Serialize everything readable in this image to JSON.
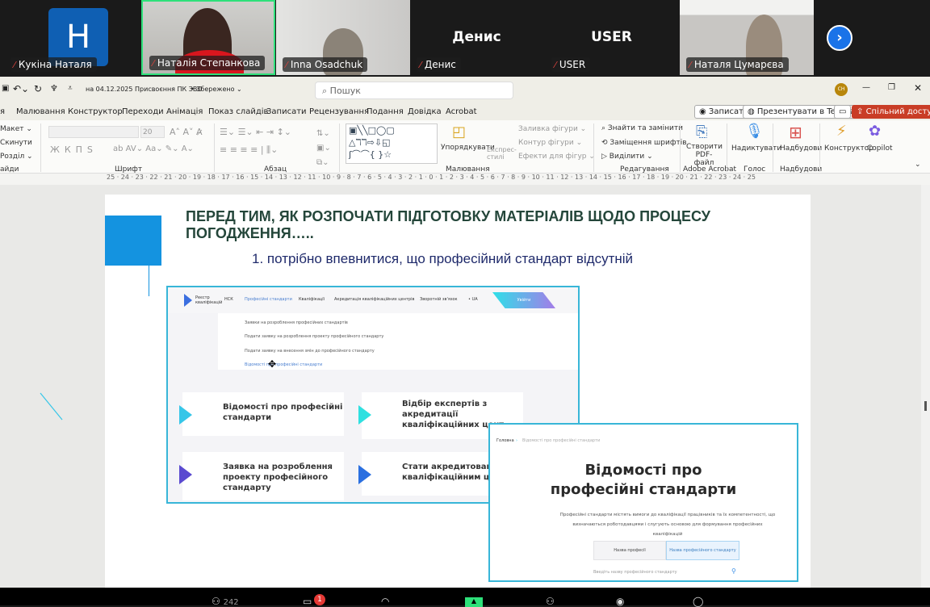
{
  "meeting": {
    "participants": [
      {
        "name": "Кукіна Наталя",
        "avatar_letter": "Н",
        "muted": true
      },
      {
        "name": "Наталія Степанкова",
        "video": true,
        "muted": true,
        "active_speaker": true
      },
      {
        "name": "Inna Osadchuk",
        "video": true,
        "muted": true
      },
      {
        "name": "Денис",
        "display_name": "Денис",
        "muted": true
      },
      {
        "name": "USER",
        "display_name": "USER",
        "muted": true
      },
      {
        "name": "Наталя Цумарєва",
        "video": true,
        "muted": true
      }
    ],
    "next_icon": "chevron-right-icon",
    "toolbar": {
      "participants_count": "242",
      "chat_badge": "1"
    }
  },
  "app": {
    "doc_title": "на 04.12.2025 Присвоєння ПК ЗВО",
    "saved": "• Збережено ⌄",
    "search_placeholder": "Пошук",
    "user_initials": "СН",
    "tabs": [
      "я",
      "Малювання",
      "Конструктор",
      "Переходи",
      "Анімація",
      "Показ слайдів",
      "Записати",
      "Рецензування",
      "Подання",
      "Довідка",
      "Acrobat"
    ],
    "record_btn": "Записати",
    "teams_btn": "Презентувати в Teams",
    "share_btn": "Спільний доступ",
    "accent": "#c93d26"
  },
  "ribbon": {
    "slides": [
      "Макет ⌄",
      "Скинути",
      "Розділ ⌄"
    ],
    "slides_group": "айди",
    "font_size": "20",
    "font_group": "Шрифт",
    "para_group": "Абзац",
    "arrange": "Упорядкувати",
    "express": "Експрес-стилі",
    "fill": "Заливка фігури ⌄",
    "outline": "Контур фігури ⌄",
    "effects": "Ефекти для фігур ⌄",
    "draw_group": "Малювання",
    "find": "Знайти та замінити",
    "replace_fonts": "Заміщення шрифтів",
    "select": "Виділити ⌄",
    "edit_group": "Редагування",
    "pdf": "Створити PDF-файл",
    "acrobat_group": "Adobe Acrobat",
    "dictate": "Надиктувати",
    "voice_group": "Голос",
    "addins": "Надбудови",
    "addins_group": "Надбудови",
    "designer": "Конструктор",
    "copilot": "Copilot"
  },
  "ruler": "25 · 24 · 23 · 22 · 21 · 20 · 19 · 18 · 17 · 16 · 15 · 14 · 13 · 12 · 11 · 10 · 9 · 8 · 7 · 6 · 5 · 4 · 3 · 2 · 1 · 0 · 1 · 2 · 3 · 4 · 5 · 6 · 7 · 8 · 9 · 10 · 11 · 12 · 13 · 14 · 15 · 16 · 17 · 18 · 19 · 20 · 21 · 22 · 23 · 24 · 25",
  "slide": {
    "title": "ПЕРЕД ТИМ, ЯК РОЗПОЧАТИ ПІДГОТОВКУ МАТЕРІАЛІВ ЩОДО ПРОЦЕСУ ПОГОДЖЕННЯ…..",
    "subtitle": "1. потрібно впевнитися, що професійний стандарт відсутній",
    "shot1": {
      "logo": "Реєстр кваліфікацій",
      "nav": [
        "НСК",
        "Професійні стандарти",
        "Кваліфікації",
        "Акредитація кваліфікаційних центрів",
        "Зворотній зв'язок",
        "• UA"
      ],
      "login": "Увійти",
      "menu": [
        "Заявки на розроблення професійних стандартів",
        "Подати заявку на розроблення проекту професійного стандарту",
        "Подати заявку на внесення змін до професійного стандарту",
        "Відомості про професійні стандарти"
      ],
      "cards": [
        "Відомості про професійні стандарти",
        "Відбір експертів з акредитації кваліфікаційних цент",
        "Заявка на розроблення проекту професійного стандарту",
        "Стати акредитованим кваліфікаційним цент"
      ]
    },
    "shot2": {
      "breadcrumb": [
        "Головна",
        "Відомості про професійні стандарти"
      ],
      "heading": "Відомості про професійні стандарти",
      "text": "Професійні стандарти містять вимоги до кваліфікації працівників та їх компетентності, що визначаються роботодавцями і слугують основою для формування професійних кваліфікацій",
      "tab1": "Назва професії",
      "tab2": "Назва професійного стандарту",
      "search_placeholder": "Введіть назву професійного стандарту"
    }
  }
}
